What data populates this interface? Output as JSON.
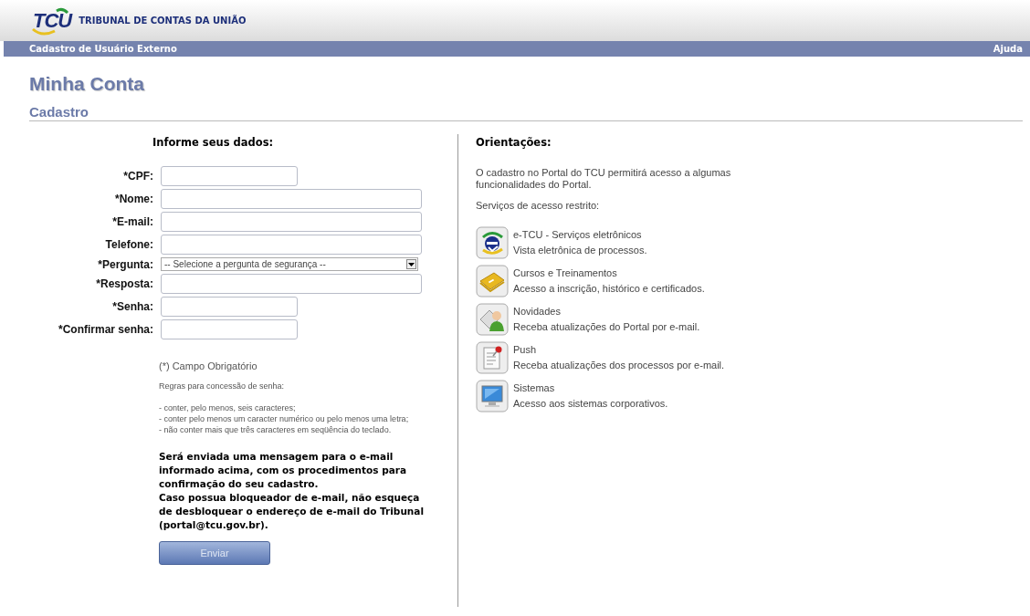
{
  "header": {
    "logo": "TCU",
    "org": "TRIBUNAL DE CONTAS DA UNIÃO"
  },
  "navbar": {
    "title": "Cadastro de Usuário Externo",
    "help": "Ajuda"
  },
  "page_title": "Minha Conta",
  "section_title": "Cadastro",
  "form": {
    "heading": "Informe seus dados:",
    "fields": [
      {
        "label": "*CPF:",
        "kind": "short"
      },
      {
        "label": "*Nome:",
        "kind": "long"
      },
      {
        "label": "*E-mail:",
        "kind": "long"
      },
      {
        "label": "Telefone:",
        "kind": "long"
      },
      {
        "label": "*Pergunta:",
        "kind": "select",
        "value": "-- Selecione a pergunta de segurança --"
      },
      {
        "label": "*Resposta:",
        "kind": "long"
      },
      {
        "label": "*Senha:",
        "kind": "short"
      },
      {
        "label": "*Confirmar senha:",
        "kind": "short"
      }
    ],
    "required_note": "(*) Campo Obrigatório",
    "rules_title": "Regras para concessão de senha:",
    "rules": [
      "- conter, pelo menos, seis caracteres;",
      "- conter pelo menos um caracter numérico ou pelo menos uma letra;",
      "- não conter mais que três caracteres em seqüência do teclado."
    ],
    "notice": [
      "Será enviada uma mensagem para o e-mail informado acima, com os procedimentos para confirmação do seu cadastro.",
      "Caso possua bloqueador de e-mail, não esqueça de desbloquear o endereço de e-mail do Tribunal (portal@tcu.gov.br)."
    ],
    "submit": "Enviar"
  },
  "guidance": {
    "heading": "Orientações:",
    "intro": "O cadastro no Portal do TCU permitirá acesso a algumas funcionalidades do Portal.",
    "services_title": "Serviços de acesso restrito:",
    "services": [
      {
        "kind": "etcu",
        "title": "e-TCU - Serviços eletrônicos",
        "description": "Vista eletrônica de processos."
      },
      {
        "kind": "book",
        "title": "Cursos e Treinamentos",
        "description": "Acesso a inscrição, histórico e certificados."
      },
      {
        "kind": "person",
        "title": "Novidades",
        "description": "Receba atualizações do Portal por e-mail."
      },
      {
        "kind": "note",
        "title": "Push",
        "description": "Receba atualizações dos processos por e-mail."
      },
      {
        "kind": "monitor",
        "title": "Sistemas",
        "description": "Acesso aos sistemas corporativos."
      }
    ]
  }
}
